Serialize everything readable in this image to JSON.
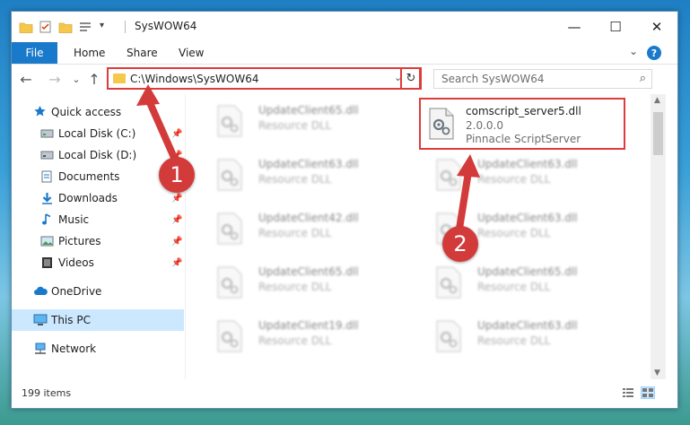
{
  "window": {
    "title": "SysWOW64",
    "controls": {
      "minimize": "—",
      "maximize": "☐",
      "close": "✕"
    }
  },
  "ribbon": {
    "tabs": [
      "File",
      "Home",
      "Share",
      "View"
    ],
    "expand_icon": "⌄",
    "help_icon": "?"
  },
  "navigation": {
    "back": "←",
    "forward": "→",
    "recent": "⌄",
    "up": "↑",
    "address": "C:\\Windows\\SysWOW64",
    "address_dropdown": "⌄",
    "refresh": "↻",
    "search_placeholder": "Search SysWOW64",
    "search_icon": "⌕"
  },
  "sidebar": {
    "items": [
      {
        "label": "Quick access",
        "icon": "star-icon",
        "pinned": false
      },
      {
        "label": "Local Disk (C:)",
        "icon": "drive-icon",
        "pinned": true
      },
      {
        "label": "Local Disk (D:)",
        "icon": "drive-icon",
        "pinned": true
      },
      {
        "label": "Documents",
        "icon": "documents-icon",
        "pinned": true
      },
      {
        "label": "Downloads",
        "icon": "download-icon",
        "pinned": true
      },
      {
        "label": "Music",
        "icon": "music-icon",
        "pinned": true
      },
      {
        "label": "Pictures",
        "icon": "pictures-icon",
        "pinned": true
      },
      {
        "label": "Videos",
        "icon": "videos-icon",
        "pinned": true
      },
      {
        "label": "OneDrive",
        "icon": "cloud-icon",
        "pinned": false
      },
      {
        "label": "This PC",
        "icon": "computer-icon",
        "pinned": false,
        "selected": true
      },
      {
        "label": "Network",
        "icon": "network-icon",
        "pinned": false
      }
    ]
  },
  "files": {
    "left_column": [
      {
        "name": "UpdateClient65.dll",
        "type": "Resource DLL"
      },
      {
        "name": "UpdateClient63.dll",
        "type": "Resource DLL"
      },
      {
        "name": "UpdateClient42.dll",
        "type": "Resource DLL"
      },
      {
        "name": "UpdateClient65.dll",
        "type": "Resource DLL"
      },
      {
        "name": "UpdateClient19.dll",
        "type": "Resource DLL"
      }
    ],
    "right_column": [
      {
        "name": "UpdateClient63.dll",
        "type": "Resource DLL"
      },
      {
        "name": "UpdateClient63.dll",
        "type": "Resource DLL"
      },
      {
        "name": "UpdateClient65.dll",
        "type": "Resource DLL"
      },
      {
        "name": "UpdateClient63.dll",
        "type": "Resource DLL"
      }
    ],
    "highlighted": {
      "name": "comscript_server5.dll",
      "version": "2.0.0.0",
      "company": "Pinnacle ScriptServer"
    }
  },
  "status": {
    "item_count": "199 items"
  },
  "annotations": {
    "step1": "1",
    "step2": "2",
    "color": "#d33b3b"
  },
  "colors": {
    "accent": "#1979ca",
    "selection": "#cce8ff",
    "highlight_border": "#e03b3b"
  }
}
